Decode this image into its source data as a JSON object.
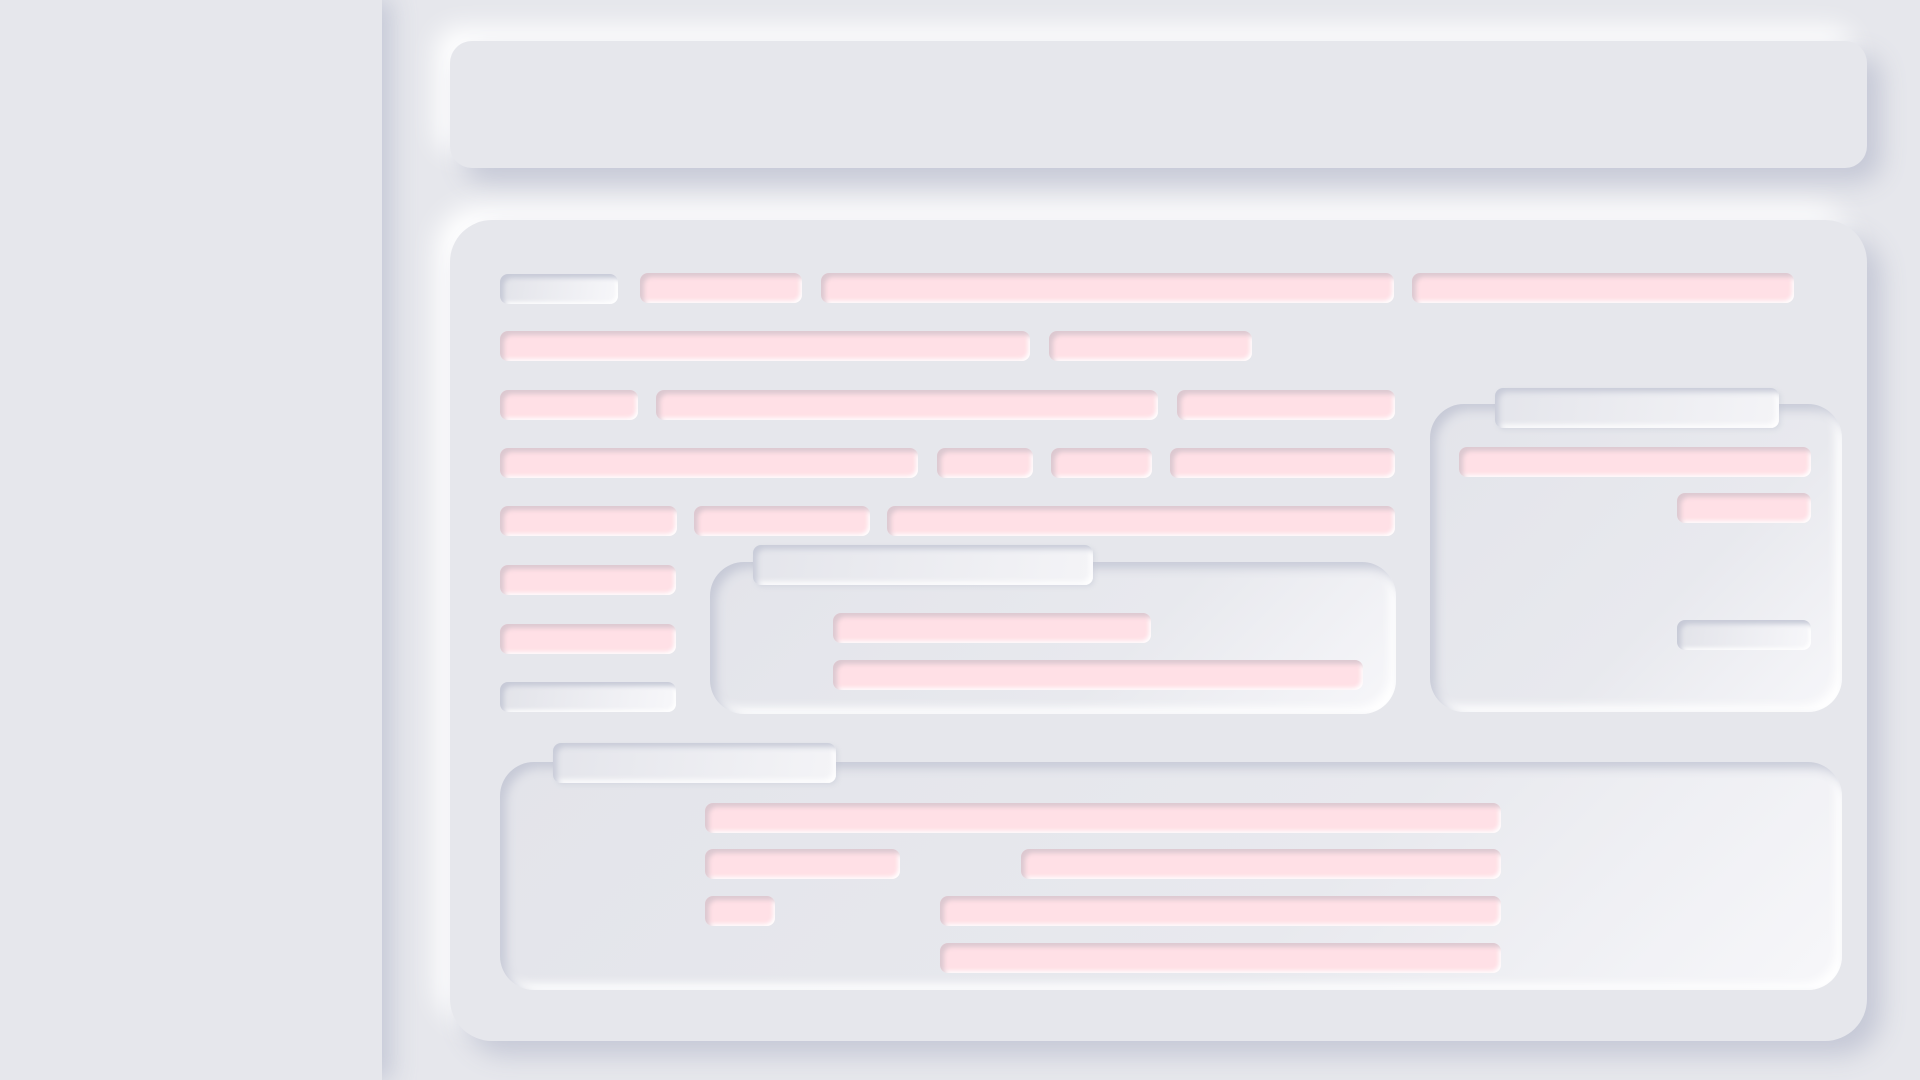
{
  "theme": {
    "background": "#e6e7ec",
    "field_fill": "#ffe0e6",
    "control_fill": "#f4f4f7"
  },
  "sidebar": {},
  "header": {},
  "form": {
    "rows": [
      {
        "fields": [
          "",
          "",
          "",
          ""
        ]
      },
      {
        "fields": [
          "",
          ""
        ]
      },
      {
        "fields": [
          "",
          "",
          ""
        ]
      },
      {
        "fields": [
          "",
          "",
          "",
          ""
        ]
      },
      {
        "fields": [
          "",
          "",
          ""
        ]
      },
      {
        "fields": [
          ""
        ]
      },
      {
        "fields": [
          ""
        ]
      },
      {
        "fields": [
          ""
        ]
      }
    ],
    "center_group": {
      "legend": "",
      "fields": [
        "",
        ""
      ]
    },
    "right_group": {
      "legend": "",
      "fields": [
        "",
        "",
        ""
      ]
    },
    "bottom_group": {
      "legend": "",
      "fields": [
        "",
        "",
        "",
        "",
        "",
        ""
      ]
    }
  }
}
